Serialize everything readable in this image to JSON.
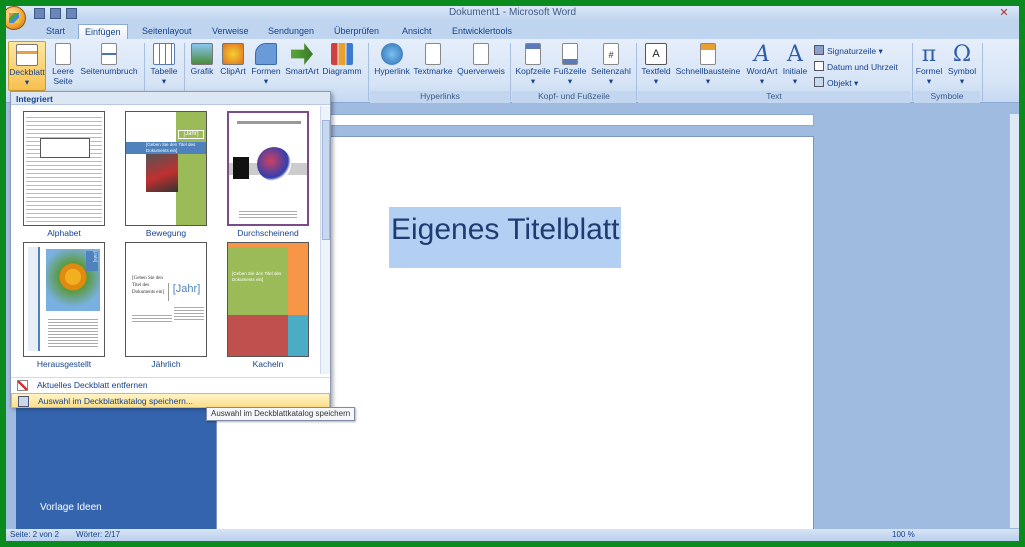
{
  "window": {
    "title": "Dokument1 - Microsoft Word"
  },
  "tabs": [
    "Start",
    "Einfügen",
    "Seitenlayout",
    "Verweise",
    "Sendungen",
    "Überprüfen",
    "Ansicht",
    "Entwicklertools"
  ],
  "ribbon": {
    "buttons": {
      "deckblatt": "Deckblatt",
      "leere_seite": "Leere Seite",
      "seitenumbruch": "Seitenumbruch",
      "tabelle": "Tabelle",
      "grafik": "Grafik",
      "clipart": "ClipArt",
      "formen": "Formen",
      "smartart": "SmartArt",
      "diagramm": "Diagramm",
      "hyperlink": "Hyperlink",
      "textmarke": "Textmarke",
      "querverweis": "Querverweis",
      "kopfzeile": "Kopfzeile",
      "fusszeile": "Fußzeile",
      "seitenzahl": "Seitenzahl",
      "textfeld": "Textfeld",
      "schnellbausteine": "Schnellbausteine",
      "wordart": "WordArt",
      "initiale": "Initiale",
      "signaturzeile": "Signaturzeile",
      "datum_uhrzeit": "Datum und Uhrzeit",
      "objekt": "Objekt",
      "formel": "Formel",
      "symbol": "Symbol"
    },
    "groups": {
      "hyperlinks": "Hyperlinks",
      "kopf_fusszeile": "Kopf- und Fußzeile",
      "text": "Text",
      "symbole": "Symbole"
    }
  },
  "gallery": {
    "header": "Integriert",
    "items": [
      "Alphabet",
      "Bewegung",
      "Durchscheinend",
      "Herausgestellt",
      "Jährlich",
      "Kacheln"
    ],
    "thumb_text": {
      "jahr": "[Jahr]",
      "bewegung_title": "[Geben Sie den Titel des Dokuments ein]",
      "jaehrlich_title": "[Geben Sie den Titel des Dokuments ein]",
      "kacheln_title": "[Geben Sie den Titel des Dokuments ein]"
    },
    "menu": {
      "remove": "Aktuelles Deckblatt entfernen",
      "save": "Auswahl im Deckblattkatalog speichern..."
    }
  },
  "tooltip": "Auswahl im Deckblattkatalog speichern",
  "document": {
    "title_text": "Eigenes Titelblatt"
  },
  "watermark": "Vorlage Ideen",
  "statusbar": {
    "page": "Seite: 2 von 2",
    "words": "Wörter: 2/17",
    "zoom": "100 %"
  }
}
